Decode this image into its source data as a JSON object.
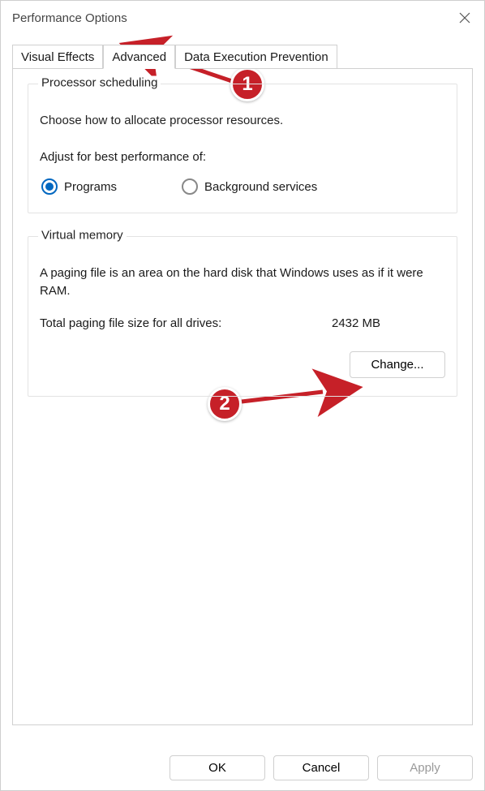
{
  "window": {
    "title": "Performance Options"
  },
  "tabs": {
    "visual_effects": "Visual Effects",
    "advanced": "Advanced",
    "dep": "Data Execution Prevention"
  },
  "processor": {
    "groupTitle": "Processor scheduling",
    "desc": "Choose how to allocate processor resources.",
    "adjustLabel": "Adjust for best performance of:",
    "option_programs": "Programs",
    "option_background": "Background services"
  },
  "virtualMemory": {
    "groupTitle": "Virtual memory",
    "desc": "A paging file is an area on the hard disk that Windows uses as if it were RAM.",
    "sizeLabel": "Total paging file size for all drives:",
    "sizeValue": "2432 MB",
    "changeButton": "Change..."
  },
  "dialogButtons": {
    "ok": "OK",
    "cancel": "Cancel",
    "apply": "Apply"
  },
  "annotations": {
    "marker1": "1",
    "marker2": "2"
  }
}
